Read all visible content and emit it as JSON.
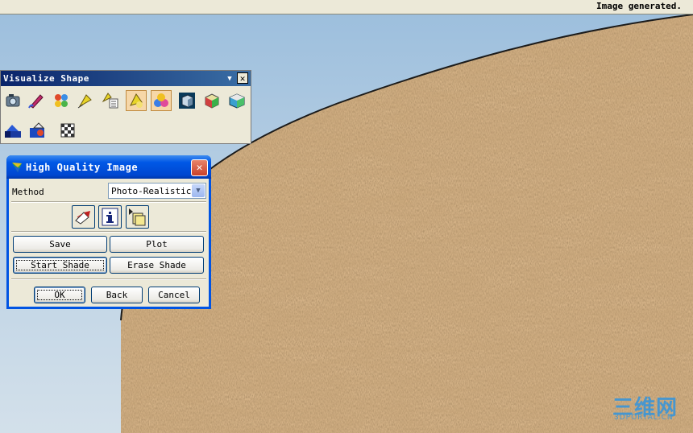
{
  "status_bar": {
    "text": "Image generated."
  },
  "visualize_toolbar": {
    "title": "Visualize Shape",
    "dropdown_glyph": "▼",
    "close_glyph": "✕",
    "icons": [
      "camera-icon",
      "brush-icon",
      "materials-icon",
      "light-icon",
      "light-list-icon",
      "spotlight-icon",
      "color-spheres-icon",
      "cube-shade-icon",
      "texture-cube-icon",
      "environment-cube-icon",
      "background-icon",
      "decal-icon",
      "checker-icon"
    ]
  },
  "dialog": {
    "title": "High Quality Image",
    "close_glyph": "✕",
    "method_label": "Method",
    "method_value": "Photo-Realistic",
    "dropdown_glyph": "▼",
    "icon_buttons": [
      "select-object-icon",
      "info-icon",
      "copy-image-icon"
    ],
    "buttons": {
      "save": "Save",
      "plot": "Plot",
      "start_shade": "Start Shade",
      "erase_shade": "Erase Shade",
      "ok": "OK",
      "back": "Back",
      "cancel": "Cancel"
    }
  },
  "watermark": {
    "main": "三维网",
    "sub": "3DPORTAL.CN"
  },
  "colors": {
    "accent": "#0054e3",
    "viewport_sky": "#a9c6e0",
    "wood": "#a0724a",
    "toolbar_title": "#0a246a"
  }
}
